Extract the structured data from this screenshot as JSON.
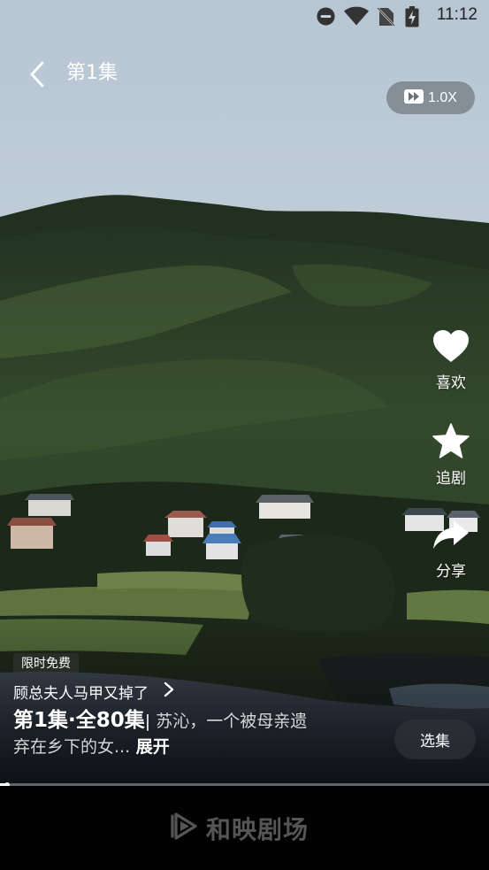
{
  "status_bar": {
    "time": "11:12",
    "icons": [
      "do-not-disturb-icon",
      "wifi-icon",
      "no-sim-icon",
      "battery-charging-icon"
    ]
  },
  "header": {
    "back_icon": "chevron-left-icon",
    "episode_title": "第1集"
  },
  "speed": {
    "icon": "fast-forward-icon",
    "label": "1.0X"
  },
  "actions": {
    "like": {
      "icon": "heart-icon",
      "label": "喜欢"
    },
    "follow": {
      "icon": "star-icon",
      "label": "追剧"
    },
    "share": {
      "icon": "share-arrow-icon",
      "label": "分享"
    }
  },
  "info": {
    "badge": "限时免费",
    "drama_name": "顾总夫人马甲又掉了",
    "drama_icon": "chevron-right-icon",
    "episode_count": "第1集·全80集",
    "separator": "|",
    "synopsis": " 苏沁，一个被母亲遗弃在乡下的女...",
    "expand_label": " 展开",
    "select_episode_label": "选集"
  },
  "progress": {
    "played_fraction": 0.014
  },
  "brand": {
    "icon": "play-logo-icon",
    "name": "和映剧场"
  },
  "colors": {
    "overlay_button": "#5a5f64",
    "brand_gray": "#555555",
    "sky": "#c9d6e1"
  }
}
